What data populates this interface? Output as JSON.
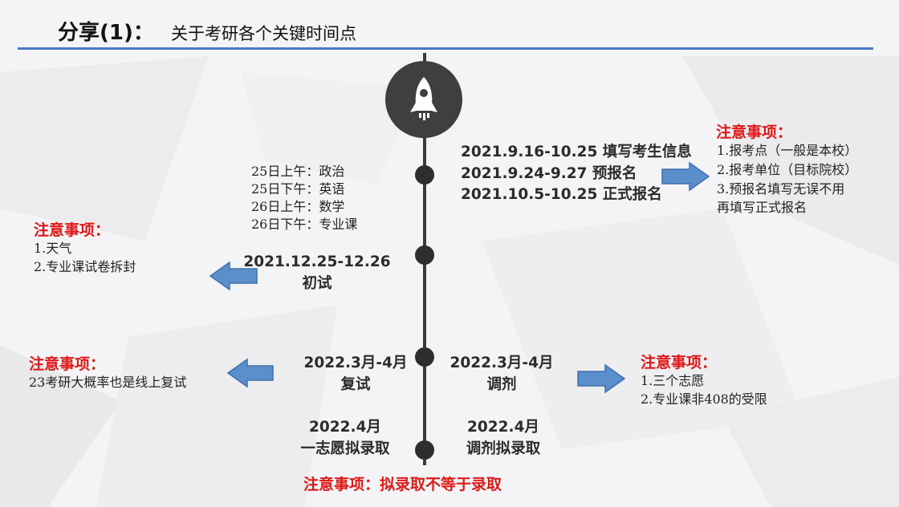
{
  "header": {
    "title": "分享(1)：",
    "subtitle": "关于考研各个关键时间点"
  },
  "registration": {
    "lines": [
      "2021.9.16-10.25 填写考生信息",
      "2021.9.24-9.27 预报名",
      "2021.10.5-10.25 正式报名"
    ],
    "note_title": "注意事项：",
    "note_items": [
      "1.报考点（一般是本校）",
      "2.报考单位（目标院校）",
      "3.预报名填写无误不用",
      "再填写正式报名"
    ]
  },
  "exam_schedule": [
    "25日上午：政治",
    "25日下午：英语",
    "26日上午：数学",
    "26日下午：专业课"
  ],
  "initial_exam": {
    "date": "2021.12.25-12.26",
    "label": "初试",
    "note_title": "注意事项：",
    "note_items": [
      "1.天气",
      "2.专业课试卷拆封"
    ]
  },
  "retest": {
    "date": "2022.3月-4月",
    "label": "复试",
    "note_title": "注意事项：",
    "note_items": [
      "23考研大概率也是线上复试"
    ]
  },
  "adjustment": {
    "date": "2022.3月-4月",
    "label": "调剂",
    "note_title": "注意事项：",
    "note_items": [
      "1.三个志愿",
      "2.专业课非408的受限"
    ]
  },
  "first_choice_admit": {
    "date": "2022.4月",
    "label": "一志愿拟录取"
  },
  "adjust_admit": {
    "date": "2022.4月",
    "label": "调剂拟录取"
  },
  "bottom_note": "注意事项：拟录取不等于录取",
  "icons": {
    "rocket": "rocket-icon",
    "arrow_right": "arrow-right-icon",
    "arrow_left": "arrow-left-icon"
  },
  "colors": {
    "accent_blue": "#4a78c0",
    "arrow_blue": "#5b8fcc",
    "note_red": "#e01818",
    "timeline_dark": "#3b3b3b"
  }
}
